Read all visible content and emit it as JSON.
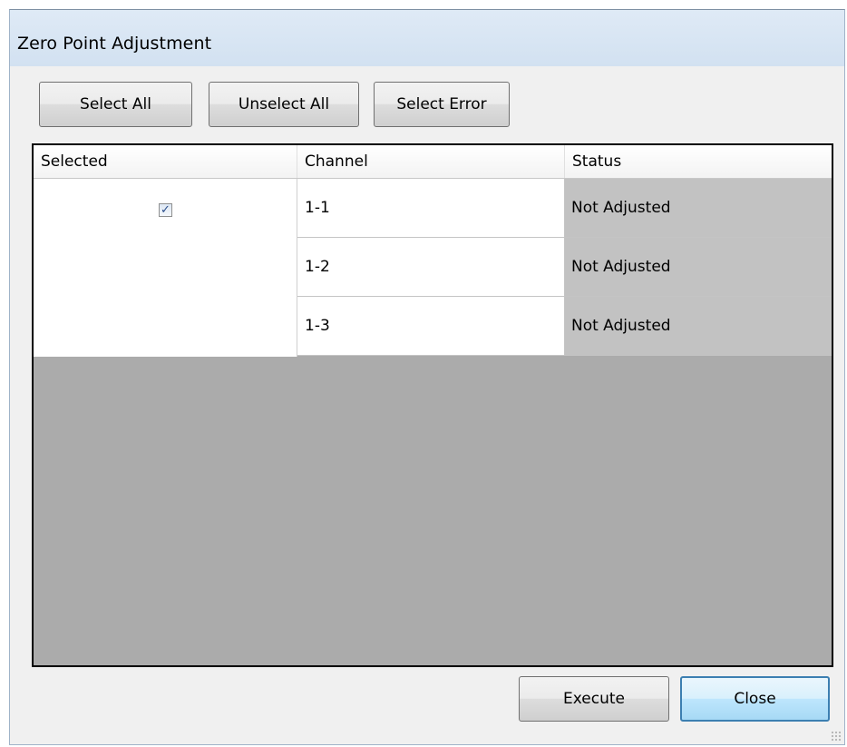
{
  "window": {
    "title": "Zero Point Adjustment"
  },
  "toolbar": {
    "select_all": "Select All",
    "unselect_all": "Unselect All",
    "select_error": "Select Error"
  },
  "table": {
    "columns": [
      "Selected",
      "Channel",
      "Status"
    ],
    "selected_checked": true,
    "rows": [
      {
        "channel": "1-1",
        "status": "Not Adjusted"
      },
      {
        "channel": "1-2",
        "status": "Not Adjusted"
      },
      {
        "channel": "1-3",
        "status": "Not Adjusted"
      }
    ]
  },
  "footer": {
    "execute": "Execute",
    "close": "Close"
  },
  "colors": {
    "title_bar": "#d6e4f3",
    "grid_empty": "#ababab",
    "status_cell": "#c2c2c2",
    "focus_border": "#3c7fb1"
  }
}
